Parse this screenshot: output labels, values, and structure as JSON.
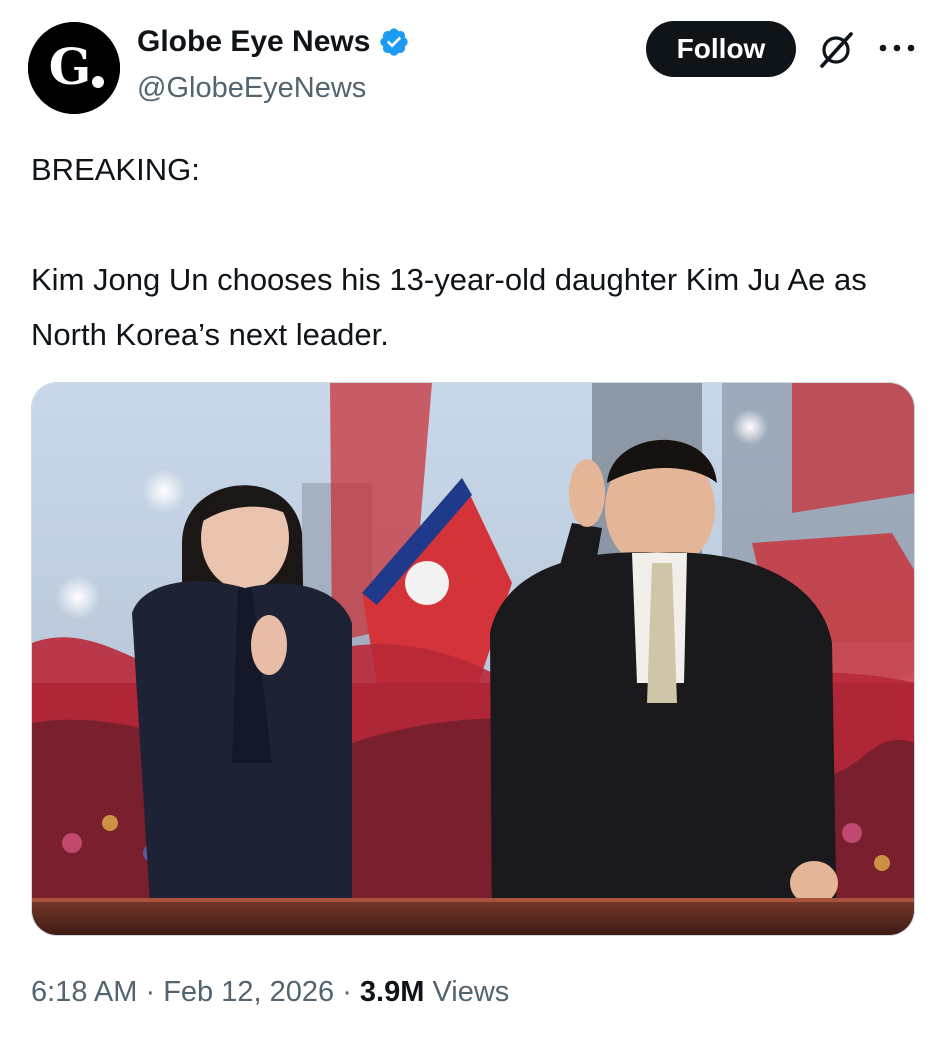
{
  "account": {
    "display_name": "Globe Eye News",
    "handle": "@GlobeEyeNews",
    "avatar_letter": "G.",
    "verified": true,
    "verified_color": "#1d9bf0"
  },
  "actions": {
    "follow_label": "Follow",
    "grok_icon": "grok-icon",
    "more_icon": "more-icon"
  },
  "tweet": {
    "lines": [
      "BREAKING:",
      "Kim Jong Un chooses his 13-year-old daughter Kim Ju Ae as North Korea’s next leader."
    ]
  },
  "media": {
    "description_icon": "photo"
  },
  "meta": {
    "time": "6:18 AM",
    "separator": "·",
    "date": "Feb 12, 2026",
    "views_count": "3.9M",
    "views_label": "Views"
  },
  "colors": {
    "text": "#0f1419",
    "secondary": "#536471",
    "follow_bg": "#0f1419"
  }
}
